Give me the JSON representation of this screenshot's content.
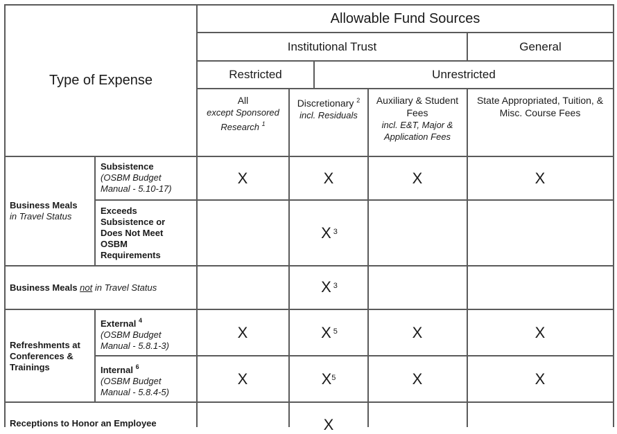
{
  "table": {
    "top_header": "Allowable Fund Sources",
    "corner_header": "Type of Expense",
    "group_headers": {
      "institutional_trust": "Institutional Trust",
      "general": "General",
      "restricted": "Restricted",
      "unrestricted": "Unrestricted"
    },
    "columns": [
      {
        "title": "All",
        "subtitle": "except Sponsored Research",
        "footnote": "1"
      },
      {
        "title": "Discretionary",
        "footnote": "2",
        "subtitle": "incl. Residuals"
      },
      {
        "title": "Auxiliary & Student Fees",
        "subtitle": "incl. E&T, Major & Application Fees"
      },
      {
        "title": "State Appropriated, Tuition, & Misc. Course Fees"
      }
    ],
    "rows": [
      {
        "category": "Business Meals",
        "category_note": "in Travel Status",
        "subrows": [
          {
            "label": "Subsistence",
            "note": "(OSBM Budget Manual - 5.10-17)",
            "marks": [
              "X",
              "X",
              "X",
              "X"
            ],
            "mark_footnotes": [
              "",
              "",
              "",
              ""
            ]
          },
          {
            "label": "Exceeds Subsistence or Does Not Meet OSBM Requirements",
            "note": "",
            "marks": [
              "",
              "X",
              "",
              ""
            ],
            "mark_footnotes": [
              "",
              "3",
              "",
              ""
            ]
          }
        ]
      },
      {
        "category": "Business Meals",
        "category_not": "not",
        "category_note": "in Travel Status",
        "marks": [
          "",
          "X",
          "",
          ""
        ],
        "mark_footnotes": [
          "",
          "3",
          "",
          ""
        ]
      },
      {
        "category": "Refreshments at Conferences & Trainings",
        "subrows": [
          {
            "label": "External",
            "label_footnote": "4",
            "note": "(OSBM Budget Manual - 5.8.1-3)",
            "marks": [
              "X",
              "X",
              "X",
              "X"
            ],
            "mark_footnotes": [
              "",
              "5",
              "",
              ""
            ]
          },
          {
            "label": "Internal",
            "label_footnote": "6",
            "note": "(OSBM Budget Manual - 5.8.4-5)",
            "marks": [
              "X",
              "X",
              "X",
              "X"
            ],
            "mark_footnotes": [
              "",
              "5",
              "",
              ""
            ]
          }
        ]
      },
      {
        "category": "Receptions to Honor an Employee",
        "marks": [
          "",
          "X",
          "",
          ""
        ],
        "mark_footnotes": [
          "",
          "",
          "",
          ""
        ]
      }
    ]
  }
}
